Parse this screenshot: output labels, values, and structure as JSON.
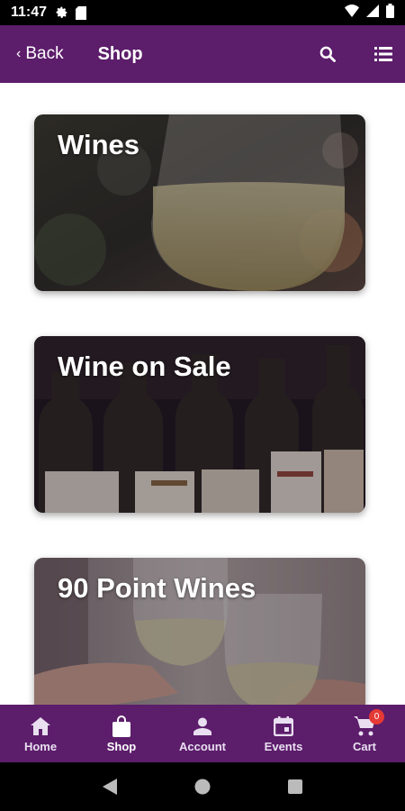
{
  "status_bar": {
    "time": "11:47",
    "icons": [
      "gear-icon",
      "sd-card-icon",
      "wifi-icon",
      "signal-icon",
      "battery-icon"
    ]
  },
  "app_bar": {
    "back_label": "Back",
    "title": "Shop",
    "actions": [
      "search-icon",
      "list-icon"
    ],
    "color": "#5c1d6b"
  },
  "categories": [
    {
      "label": "Wines"
    },
    {
      "label": "Wine on Sale"
    },
    {
      "label": "90 Point Wines"
    }
  ],
  "bottom_nav": {
    "items": [
      {
        "label": "Home",
        "icon": "home-icon"
      },
      {
        "label": "Shop",
        "icon": "shopping-bag-icon",
        "active": true
      },
      {
        "label": "Account",
        "icon": "account-icon"
      },
      {
        "label": "Events",
        "icon": "calendar-icon"
      },
      {
        "label": "Cart",
        "icon": "cart-icon",
        "badge": "0"
      }
    ]
  }
}
